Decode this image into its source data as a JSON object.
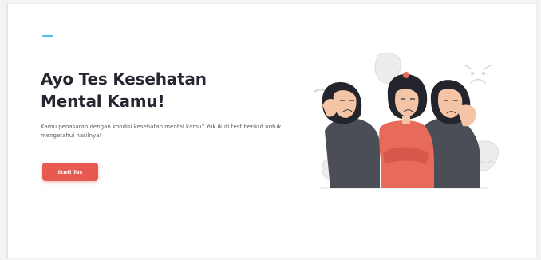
{
  "hero": {
    "heading_line1": "Ayo Tes Kesehatan",
    "heading_line2": "Mental Kamu!",
    "description": "Kamu penasaran dengan kondisi kesehatan mental kamu? Yuk ikuti test berikut untuk mengetahui hasilnya!",
    "cta_label": "Ikuti Tes"
  },
  "colors": {
    "accent": "#e85a4f",
    "logo": "#47c2e6",
    "heading": "#262631"
  },
  "icons": {
    "logo": "brand-logo",
    "illustration": "mental-health-illustration"
  }
}
